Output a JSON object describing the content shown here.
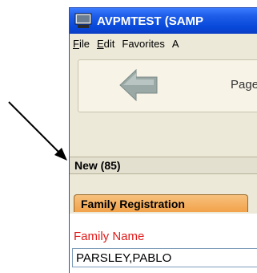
{
  "window": {
    "title": "AVPMTEST (SAMP"
  },
  "menu": {
    "items": [
      {
        "first": "F",
        "rest": "ile"
      },
      {
        "first": "E",
        "rest": "dit"
      },
      {
        "first": "",
        "rest": "Favorites"
      },
      {
        "first": "",
        "rest": "A"
      }
    ]
  },
  "toolbar": {
    "back_icon": "back-arrow-icon",
    "page_label": "Page"
  },
  "status": {
    "text": "New (85)"
  },
  "tabs": {
    "active_label": "Family Registration"
  },
  "form": {
    "family_name_label": "Family Name",
    "family_name_value": "PARSLEY,PABLO"
  },
  "colors": {
    "title_bar": "#0848d9",
    "tab": "#f2a24a",
    "required_label": "#e21b1b"
  }
}
